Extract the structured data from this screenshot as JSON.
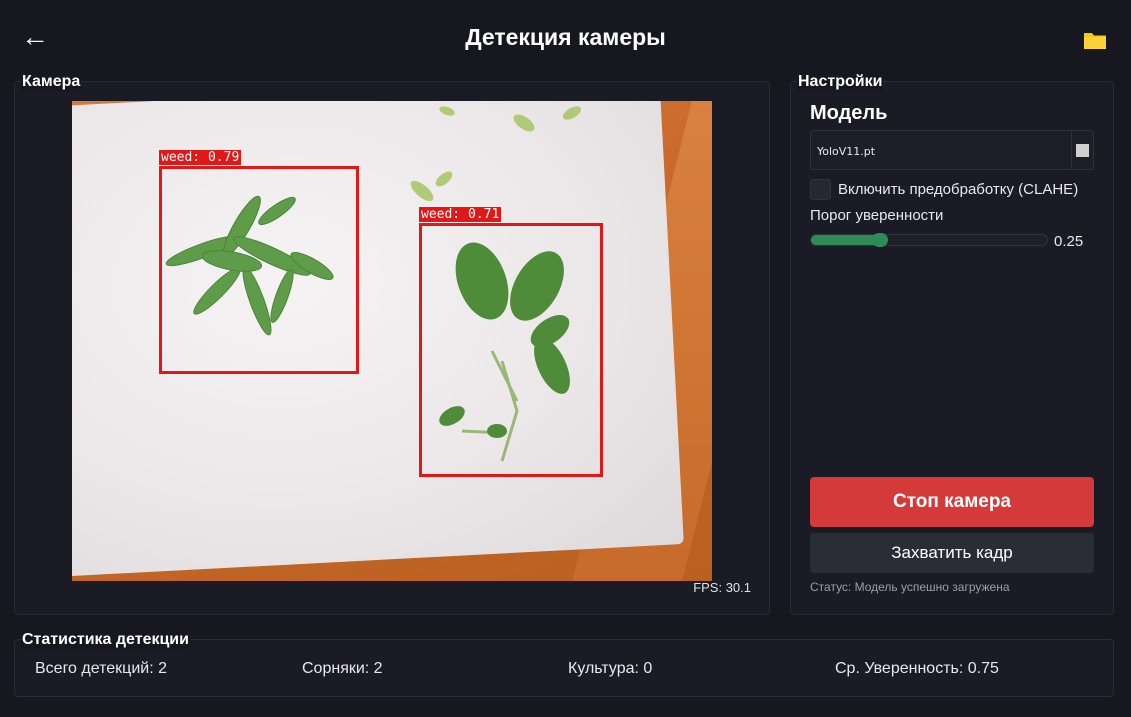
{
  "header": {
    "back_icon": "←",
    "title": "Детекция камеры",
    "folder_color": "#f5c518"
  },
  "camera": {
    "group_label": "Камера",
    "fps_text": "FPS: 30.1",
    "detections": [
      {
        "label": "weed: 0.79"
      },
      {
        "label": "weed: 0.71"
      }
    ],
    "box_color": "#e01818"
  },
  "settings": {
    "group_label": "Настройки",
    "model_title": "Модель",
    "model_value": "YoloV11.pt",
    "clahe_label": "Включить предобработку (CLAHE)",
    "clahe_checked": false,
    "threshold_label": "Порог уверенности",
    "threshold_value": "0.25",
    "threshold_fraction": 0.25,
    "stop_button": "Стоп камера",
    "capture_button": "Захватить кадр",
    "status_text": "Статус: Модель успешно загружена",
    "stop_color": "#d43a3a",
    "slider_color": "#2e8b57"
  },
  "stats": {
    "group_label": "Статистика детекции",
    "total": "Всего детекций: 2",
    "weeds": "Сорняки: 2",
    "crops": "Культура: 0",
    "avg_confidence": "Ср. Уверенность: 0.75"
  }
}
